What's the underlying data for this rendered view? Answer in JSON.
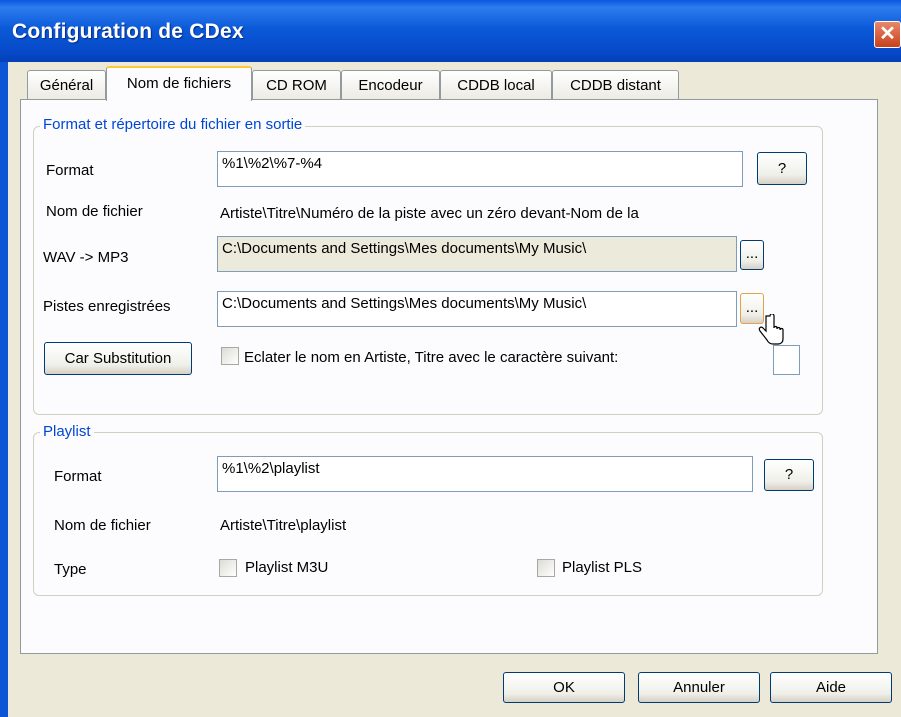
{
  "window": {
    "title": "Configuration de CDex",
    "close_glyph": "✕"
  },
  "tabs": [
    "Général",
    "Nom de fichiers",
    "CD ROM",
    "Encodeur",
    "CDDB local",
    "CDDB distant"
  ],
  "output_group": {
    "legend": "Format et répertoire du fichier en sortie",
    "format_label": "Format",
    "format_value": "%1\\%2\\%7-%4",
    "help_label": "?",
    "filename_label": "Nom de fichier",
    "filename_value": "Artiste\\Titre\\Numéro de la piste avec un zéro devant-Nom de la",
    "wav_mp3_label": "WAV -> MP3",
    "wav_mp3_value": "C:\\Documents and Settings\\Mes documents\\My Music\\",
    "browse_label": "...",
    "tracks_label": "Pistes enregistrées",
    "tracks_value": "C:\\Documents and Settings\\Mes documents\\My Music\\",
    "car_sub_label": "Car Substitution",
    "split_label": "Eclater le nom en Artiste, Titre avec le caractère suivant:",
    "split_char_value": ""
  },
  "playlist_group": {
    "legend": "Playlist",
    "format_label": "Format",
    "format_value": "%1\\%2\\playlist",
    "help_label": "?",
    "filename_label": "Nom de fichier",
    "filename_value": "Artiste\\Titre\\playlist",
    "type_label": "Type",
    "m3u_label": "Playlist M3U",
    "pls_label": "Playlist PLS"
  },
  "footer": {
    "ok": "OK",
    "cancel": "Annuler",
    "help": "Aide"
  },
  "colors": {
    "title_bar": "#0b5ad8",
    "legend_text": "#0046d5",
    "dialog_bg": "#ece9d8"
  }
}
